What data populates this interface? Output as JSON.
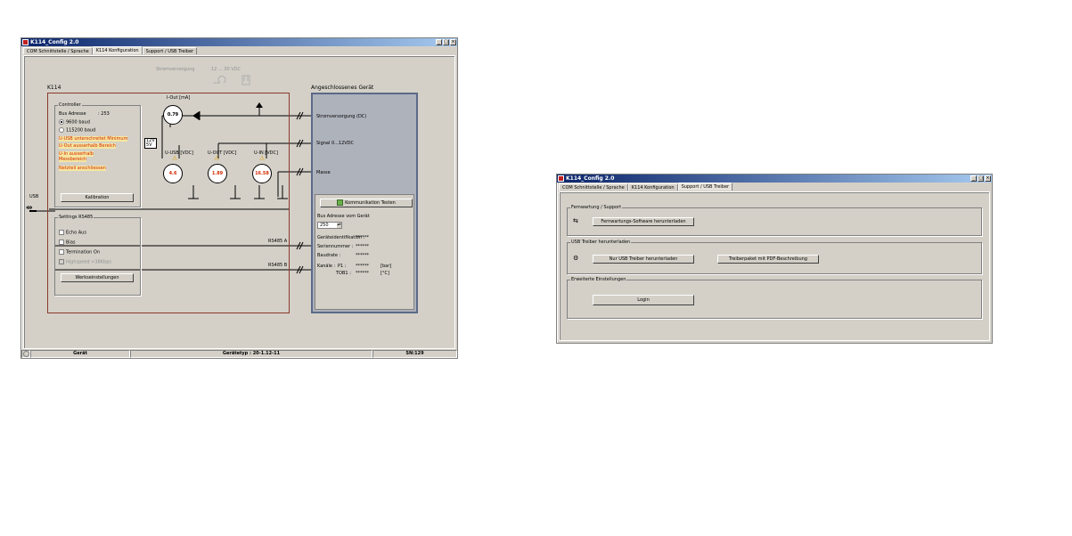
{
  "window1": {
    "title": "K114_Config 2.0",
    "controls": {
      "minimize": "_",
      "maximize": "□",
      "close": "×"
    },
    "tabs": [
      {
        "label": "COM Schnittstelle / Sprache",
        "active": false
      },
      {
        "label": "K114 Konfiguration",
        "active": true
      },
      {
        "label": "Support / USB Treiber",
        "active": false
      }
    ],
    "power_label": "Stromversorgung",
    "power_range": "12 ... 30 VDC",
    "k114_label": "K114",
    "device_label": "Angeschlossenes Gerät",
    "usb_label": "USB",
    "controller": {
      "title": "Controller",
      "bus_address_label": "Bus Adresse",
      "bus_address_value": ": 253",
      "baud_9600": "9600 baud",
      "baud_115200": "115200 baud",
      "warnings": [
        "U-USB unterschreitet Minimum",
        "U-Out ausserhalb Bereich",
        "U-In ausserhalb",
        "Messbereich",
        "Netzteil anschliessen"
      ],
      "calibration_button": "Kalibration"
    },
    "gauges": {
      "iout_label": "I-Out [mA]",
      "iout_value": "0.79",
      "uusb_label": "U-USB [VDC]",
      "uusb_value": "4.6",
      "uout_label": "U-OUT [VDC]",
      "uout_value": "1.89",
      "uin_label": "U-IN [VDC]",
      "uin_value": "16.58",
      "switch_12v": "12V",
      "switch_5v": "5V"
    },
    "rs485": {
      "title": "Settings RS485",
      "options": [
        "Echo Aus",
        "Bias",
        "Termination On",
        "Highspeed >38Kbps"
      ],
      "factory_button": "Werkseinstellungen",
      "line_a": "RS485 A",
      "line_b": "RS485 B"
    },
    "device": {
      "power_supply": "Stromversorgung (DC)",
      "signal": "Signal 0...12VDC",
      "ground": "Masse",
      "test_button": "Kommunikation Testen",
      "bus_address_label": "Bus Adresse vom Gerät",
      "bus_address_value": "250",
      "identification_label": "Geräteidentifikation :",
      "identification_value": "******",
      "serial_label": "Seriennummer :",
      "serial_value": "******",
      "baud_label": "Baudrate :",
      "baud_value": "******",
      "channels_label": "Kanäle :",
      "ch1_name": "P1 :",
      "ch1_value": "******",
      "ch1_unit": "[bar]",
      "ch2_name": "TOB1 :",
      "ch2_value": "******",
      "ch2_unit": "[°C]"
    },
    "status": {
      "device": "Gerät",
      "device_type": "Gerätetyp : 20-1.12-11",
      "serial": "SN:129"
    }
  },
  "window2": {
    "title": "K114_Config 2.0",
    "controls": {
      "minimize": "_",
      "maximize": "□",
      "close": "×"
    },
    "tabs": [
      {
        "label": "COM Schnittstelle / Sprache",
        "active": false
      },
      {
        "label": "K114 Konfiguration",
        "active": false
      },
      {
        "label": "Support / USB Treiber",
        "active": true
      }
    ],
    "remote": {
      "title": "Fernwartung / Support",
      "download_button": "Fernwartungs-Software herunterladen"
    },
    "usb": {
      "title": "USB Treiber herunterladen",
      "only_driver_button": "Nur USB Treiber herunterladen",
      "package_button": "Treiberpaket mit PDF-Beschreibung"
    },
    "advanced": {
      "title": "Erweiterte Einstellungen",
      "login_button": "Login"
    }
  }
}
